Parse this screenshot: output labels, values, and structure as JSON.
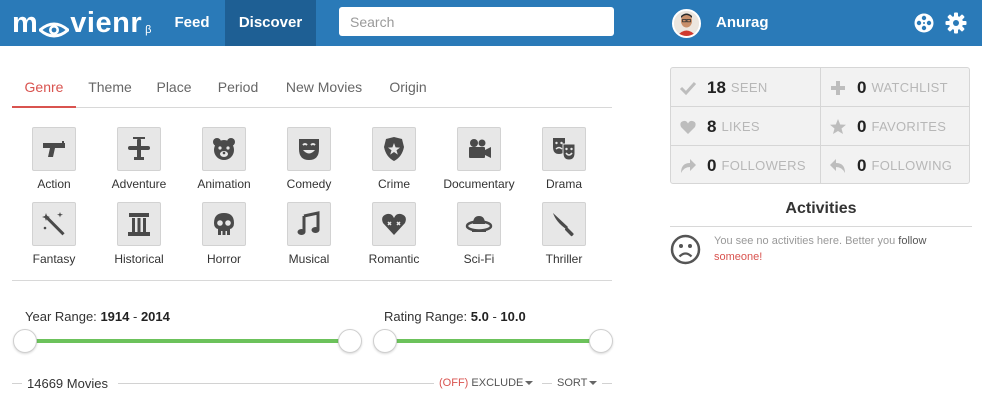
{
  "app": {
    "logo_text_1": "m",
    "logo_text_2": "vienr",
    "logo_beta": "β"
  },
  "nav": {
    "feed": "Feed",
    "discover": "Discover"
  },
  "search": {
    "placeholder": "Search"
  },
  "user": {
    "name": "Anurag"
  },
  "tabs": [
    "Genre",
    "Theme",
    "Place",
    "Period",
    "New Movies",
    "Origin"
  ],
  "active_tab": "Genre",
  "genres": [
    {
      "label": "Action",
      "icon": "gun-icon"
    },
    {
      "label": "Adventure",
      "icon": "plane-icon"
    },
    {
      "label": "Animation",
      "icon": "bear-icon"
    },
    {
      "label": "Comedy",
      "icon": "comedy-mask-icon"
    },
    {
      "label": "Crime",
      "icon": "police-badge-icon"
    },
    {
      "label": "Documentary",
      "icon": "video-camera-icon"
    },
    {
      "label": "Drama",
      "icon": "drama-masks-icon"
    },
    {
      "label": "Fantasy",
      "icon": "magic-wand-icon"
    },
    {
      "label": "Historical",
      "icon": "column-icon"
    },
    {
      "label": "Horror",
      "icon": "skull-icon"
    },
    {
      "label": "Musical",
      "icon": "music-note-icon"
    },
    {
      "label": "Romantic",
      "icon": "heart-icon"
    },
    {
      "label": "Sci-Fi",
      "icon": "ufo-icon"
    },
    {
      "label": "Thriller",
      "icon": "knife-icon"
    }
  ],
  "year_range": {
    "label": "Year Range:",
    "min": "1914",
    "sep": "-",
    "max": "2014"
  },
  "rating_range": {
    "label": "Rating Range:",
    "min": "5.0",
    "sep": "-",
    "max": "10.0"
  },
  "results": {
    "count_label": "14669 Movies",
    "exclude_status": "(OFF)",
    "exclude_label": "EXCLUDE",
    "sort_label": "SORT"
  },
  "stats": {
    "seen": {
      "value": "18",
      "label": "SEEN"
    },
    "watchlist": {
      "value": "0",
      "label": "WATCHLIST"
    },
    "likes": {
      "value": "8",
      "label": "LIKES"
    },
    "favorites": {
      "value": "0",
      "label": "FAVORITES"
    },
    "followers": {
      "value": "0",
      "label": "FOLLOWERS"
    },
    "following": {
      "value": "0",
      "label": "FOLLOWING"
    }
  },
  "activities": {
    "title": "Activities",
    "empty_text": "You see no activities here. Better you",
    "follow_word": "follow",
    "someone_link": "someone!"
  },
  "colors": {
    "header_bg": "#2a7ab8",
    "active_nav_bg": "#1e5f94",
    "accent_red": "#d9534f",
    "slider_green": "#6cc25b"
  }
}
